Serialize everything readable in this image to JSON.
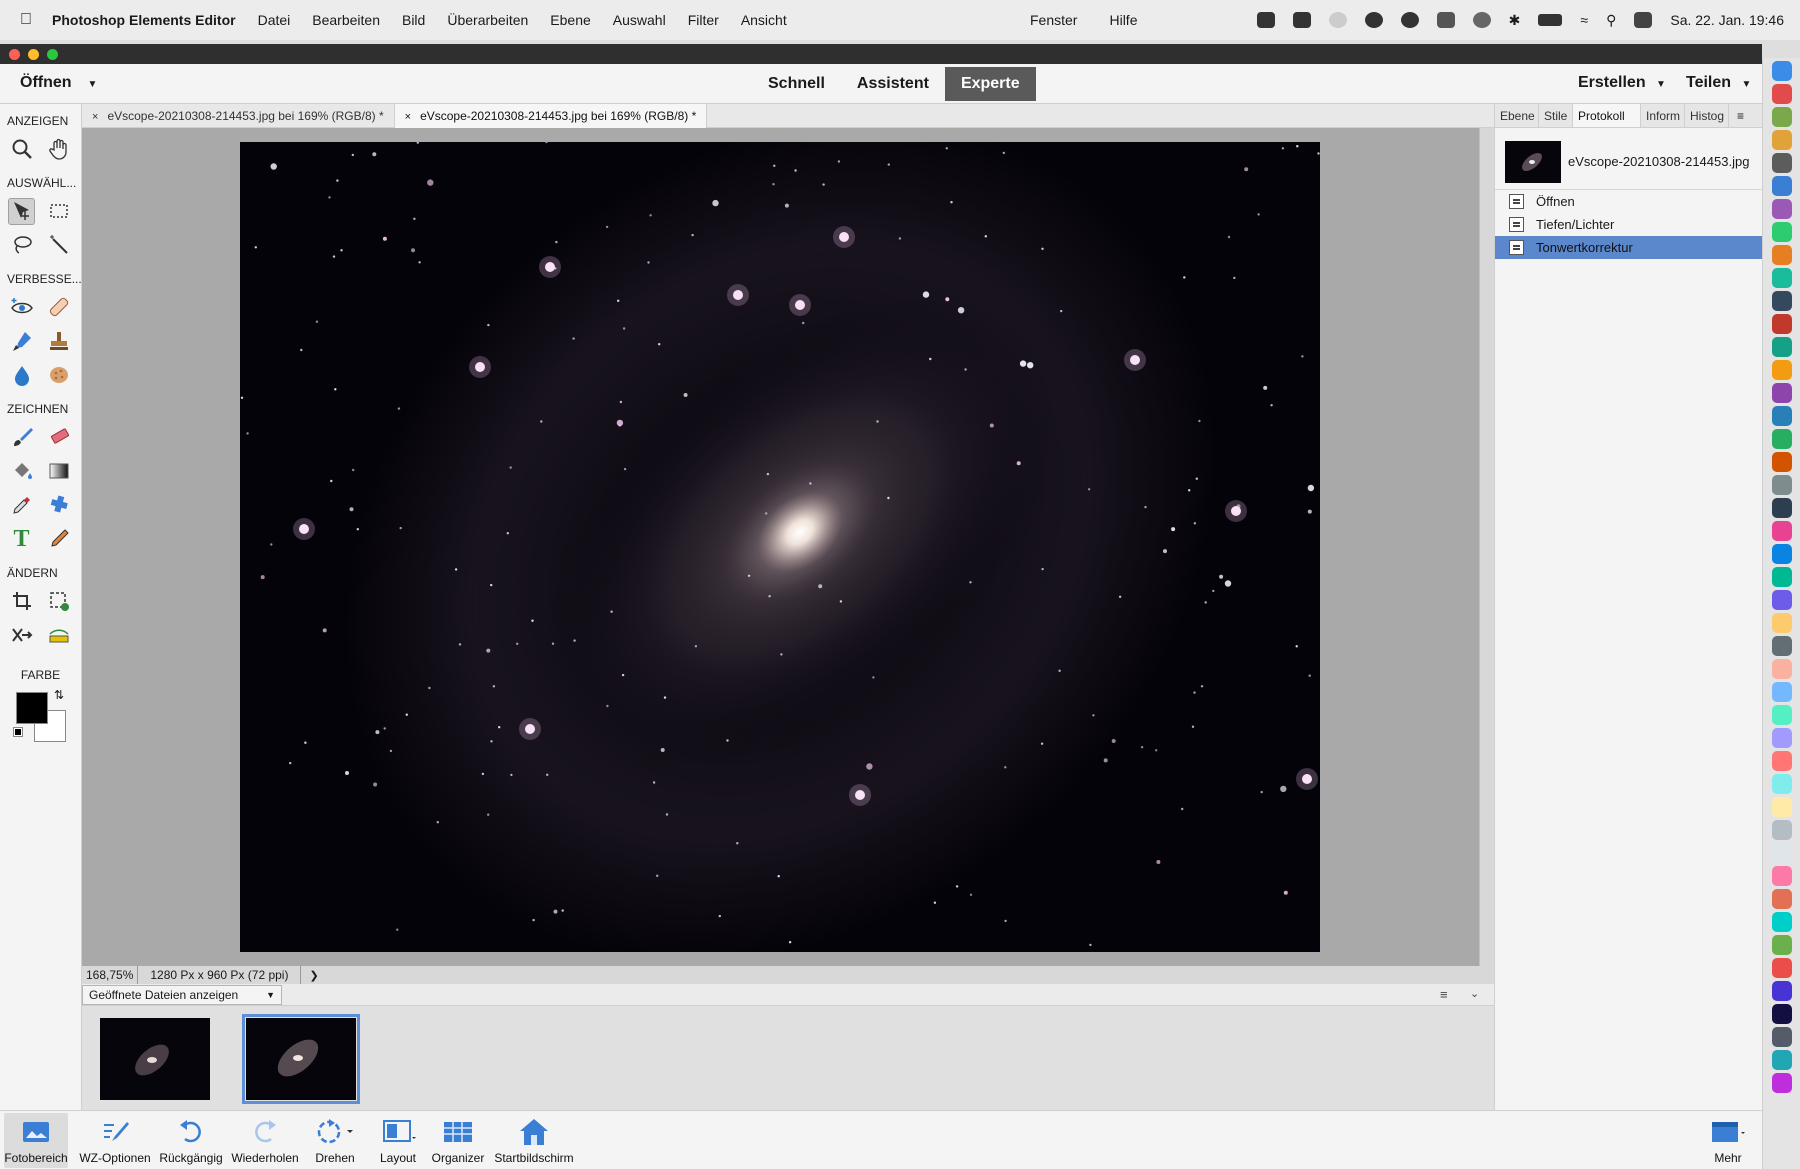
{
  "menubar": {
    "app_name": "Photoshop Elements Editor",
    "items": [
      "Datei",
      "Bearbeiten",
      "Bild",
      "Überarbeiten",
      "Ebene",
      "Auswahl",
      "Filter",
      "Ansicht"
    ],
    "items_right": [
      "Fenster",
      "Hilfe"
    ],
    "clock": "Sa. 22. Jan.  19:46"
  },
  "topbar": {
    "open_label": "Öffnen",
    "modes": [
      "Schnell",
      "Assistent",
      "Experte"
    ],
    "active_mode": "Experte",
    "create_label": "Erstellen",
    "share_label": "Teilen"
  },
  "toolbox": {
    "sections": {
      "view": "ANZEIGEN",
      "select": "AUSWÄHL...",
      "enhance": "VERBESSE...",
      "draw": "ZEICHNEN",
      "modify": "ÄNDERN",
      "color": "FARBE"
    },
    "colors": {
      "foreground": "#000000",
      "background": "#ffffff"
    }
  },
  "tabs": [
    {
      "label": "eVscope-20210308-214453.jpg bei 169% (RGB/8) *",
      "active": false
    },
    {
      "label": "eVscope-20210308-214453.jpg bei 169% (RGB/8) *",
      "active": true
    }
  ],
  "status": {
    "zoom": "168,75%",
    "dimensions": "1280 Px x 960 Px (72 ppi)"
  },
  "photo_bin": {
    "dropdown_label": "Geöffnete Dateien anzeigen"
  },
  "right_panel": {
    "tabs": [
      "Ebene",
      "Stile",
      "Protokoll",
      "Inform",
      "Histog"
    ],
    "active_tab": "Protokoll",
    "snapshot_name": "eVscope-20210308-214453.jpg",
    "history": [
      "Öffnen",
      "Tiefen/Lichter",
      "Tonwertkorrektur"
    ],
    "selected_history": "Tonwertkorrektur"
  },
  "bottombar": {
    "buttons": [
      "Fotobereich",
      "WZ-Optionen",
      "Rückgängig",
      "Wiederholen",
      "Drehen",
      "Layout",
      "Organizer",
      "Startbildschirm"
    ],
    "more_label": "Mehr"
  },
  "accent_color": "#5b88cc"
}
